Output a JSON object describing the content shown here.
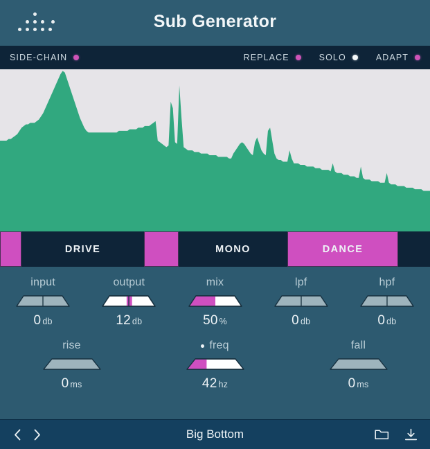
{
  "window": {
    "title": "Sub Generator",
    "logo_name": "dot-matrix-logo"
  },
  "toggles": [
    {
      "label": "SIDE-CHAIN",
      "led": "magenta",
      "name": "side-chain"
    },
    {
      "label": "REPLACE",
      "led": "magenta",
      "name": "replace"
    },
    {
      "label": "SOLO",
      "led": "white",
      "name": "solo"
    },
    {
      "label": "ADAPT",
      "led": "magenta",
      "name": "adapt"
    }
  ],
  "spectrum": {
    "background": "#e6e4e8",
    "fill": "#31a87f",
    "label": "frequency-spectrum-analyzer"
  },
  "modes": [
    {
      "label": "DRIVE",
      "active": true,
      "name": "drive"
    },
    {
      "label": "MONO",
      "active": true,
      "name": "mono"
    },
    {
      "label": "DANCE",
      "active": true,
      "name": "dance"
    }
  ],
  "controls_row1": [
    {
      "name": "input",
      "label": "input",
      "value": "0",
      "unit": "db",
      "fill_pct": 0,
      "style": "grey",
      "divider": true,
      "width": "narrow",
      "dot": false
    },
    {
      "name": "output",
      "label": "output",
      "value": "12",
      "unit": "db",
      "fill_pct": 50,
      "style": "white",
      "divider": true,
      "width": "narrow",
      "dot": false
    },
    {
      "name": "mix",
      "label": "mix",
      "value": "50",
      "unit": "%",
      "fill_pct": 50,
      "style": "white",
      "divider": false,
      "width": "narrow",
      "dot": false
    },
    {
      "name": "lpf",
      "label": "lpf",
      "value": "0",
      "unit": "db",
      "fill_pct": 0,
      "style": "grey",
      "divider": true,
      "width": "narrow",
      "dot": false
    },
    {
      "name": "hpf",
      "label": "hpf",
      "value": "0",
      "unit": "db",
      "fill_pct": 0,
      "style": "grey",
      "divider": true,
      "width": "narrow",
      "dot": false
    }
  ],
  "controls_row2": [
    {
      "name": "rise",
      "label": "rise",
      "value": "0",
      "unit": "ms",
      "fill_pct": 0,
      "style": "grey",
      "divider": false,
      "width": "wide",
      "dot": false
    },
    {
      "name": "freq",
      "label": "freq",
      "value": "42",
      "unit": "hz",
      "fill_pct": 35,
      "style": "white",
      "divider": false,
      "width": "wide",
      "dot": true
    },
    {
      "name": "fall",
      "label": "fall",
      "value": "0",
      "unit": "ms",
      "fill_pct": 0,
      "style": "grey",
      "divider": false,
      "width": "wide",
      "dot": false
    }
  ],
  "footer": {
    "prev_label": "‹",
    "next_label": "›",
    "preset_name": "Big Bottom",
    "browse_icon": "folder-icon",
    "save_icon": "download-icon"
  },
  "colors": {
    "accent_magenta": "#cf4fc0",
    "spectrum_green": "#31a87f",
    "panel_blue": "#2d5a70",
    "bar_dark": "#0e2438",
    "footer_blue": "#14405f"
  },
  "chart_data": {
    "type": "area",
    "title": "",
    "xlabel": "",
    "ylabel": "",
    "grid": false,
    "legend": "none",
    "series": [
      {
        "name": "spectrum",
        "color": "#31a87f",
        "values": [
          56,
          56,
          56,
          56,
          57,
          57,
          58,
          59,
          60,
          62,
          64,
          65,
          66,
          66,
          67,
          67,
          67,
          68,
          69,
          71,
          73,
          76,
          79,
          82,
          85,
          88,
          91,
          94,
          97,
          99,
          98,
          94,
          90,
          86,
          82,
          78,
          74,
          70,
          67,
          64,
          62,
          61,
          61,
          61,
          61,
          61,
          61,
          61,
          61,
          61,
          61,
          61,
          61,
          61,
          61,
          62,
          62,
          62,
          62,
          62,
          63,
          63,
          63,
          63,
          64,
          64,
          64,
          65,
          65,
          65,
          66,
          67,
          68,
          56,
          55,
          54,
          53,
          52,
          53,
          80,
          76,
          55,
          54,
          90,
          70,
          52,
          51,
          50,
          50,
          50,
          49,
          49,
          49,
          48,
          48,
          48,
          48,
          47,
          47,
          47,
          47,
          46,
          46,
          46,
          46,
          46,
          45,
          45,
          48,
          50,
          52,
          54,
          55,
          54,
          52,
          50,
          48,
          47,
          55,
          58,
          54,
          50,
          48,
          47,
          62,
          64,
          56,
          48,
          45,
          44,
          44,
          43,
          43,
          43,
          50,
          45,
          42,
          42,
          42,
          41,
          41,
          41,
          40,
          40,
          40,
          40,
          39,
          39,
          39,
          38,
          38,
          38,
          38,
          37,
          42,
          37,
          36,
          36,
          36,
          35,
          35,
          35,
          34,
          34,
          34,
          33,
          33,
          40,
          33,
          32,
          32,
          32,
          31,
          31,
          31,
          31,
          30,
          30,
          30,
          36,
          30,
          29,
          29,
          29,
          28,
          28,
          28,
          28,
          27,
          27,
          27,
          27,
          26,
          26,
          26,
          26,
          25,
          25,
          25,
          25
        ]
      }
    ],
    "ylim": [
      0,
      100
    ],
    "xlim": [
      0,
      200
    ]
  }
}
